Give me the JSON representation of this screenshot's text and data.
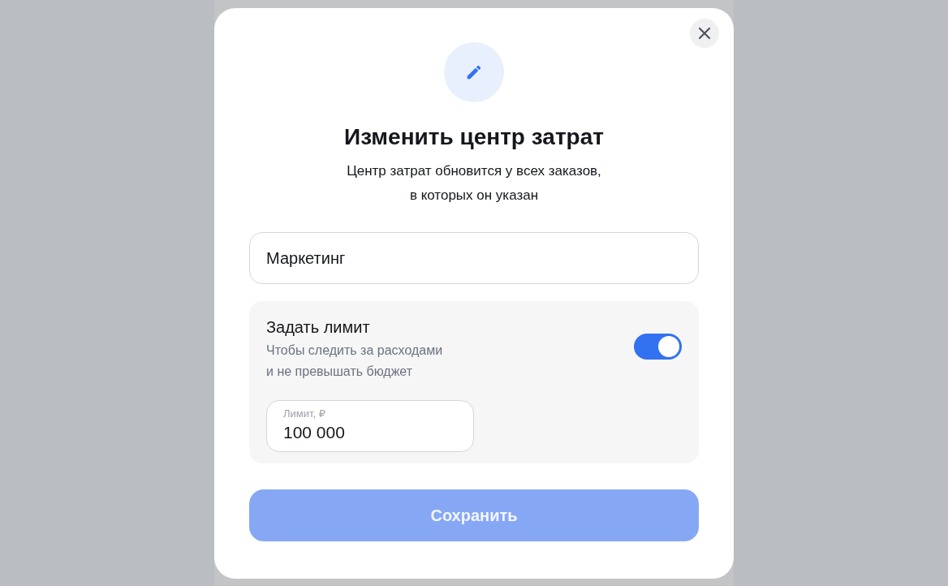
{
  "dialog": {
    "title": "Изменить центр затрат",
    "subtitle": "Центр затрат обновится у всех заказов,\nв которых он указан"
  },
  "name_field": {
    "value": "Маркетинг"
  },
  "limit": {
    "title": "Задать лимит",
    "description": "Чтобы следить за расходами\nи не превышать бюджет",
    "on": true,
    "field": {
      "label": "Лимит, ₽",
      "value": "100 000"
    }
  },
  "save_button": {
    "label": "Сохранить",
    "disabled": true
  }
}
